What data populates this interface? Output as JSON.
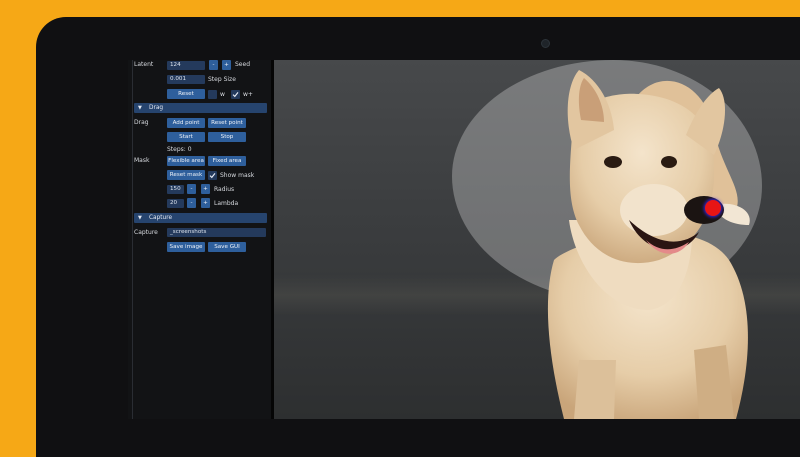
{
  "gui": {
    "latent": {
      "label": "Latent",
      "value": "124",
      "minus": "-",
      "plus": "+",
      "seed_label": "Seed"
    },
    "step_size": {
      "value": "0.001",
      "label": "Step Size"
    },
    "reset_row": {
      "reset": "Reset",
      "w_label": "w",
      "wplus_label": "w+",
      "w_checked": false,
      "wplus_checked": true
    },
    "drag_section": {
      "header": "Drag",
      "drag_label": "Drag",
      "add_point": "Add point",
      "reset_point": "Reset point",
      "start": "Start",
      "stop": "Stop",
      "steps": "Steps: 0"
    },
    "mask_section": {
      "label": "Mask",
      "flexible_area": "Flexible area",
      "fixed_area": "Fixed area",
      "reset_mask": "Reset mask",
      "show_mask": "Show mask",
      "show_mask_checked": true,
      "radius": {
        "value": "150",
        "minus": "-",
        "plus": "+",
        "label": "Radius"
      },
      "lambda": {
        "value": "20",
        "minus": "-",
        "plus": "+",
        "label": "Lambda"
      }
    },
    "capture_section": {
      "header": "Capture",
      "label": "Capture",
      "path": "_screenshots",
      "save_image": "Save image",
      "save_gui": "Save GUI"
    }
  },
  "colors": {
    "background": "#f6a816",
    "panel": "#121315",
    "field": "#243a5c",
    "button": "#2e5f9c",
    "section_header": "#26446e",
    "handle_point": "#e81515"
  },
  "icons": {
    "section_toggle": "triangle-down-icon",
    "checkbox": "checkmark-icon"
  }
}
